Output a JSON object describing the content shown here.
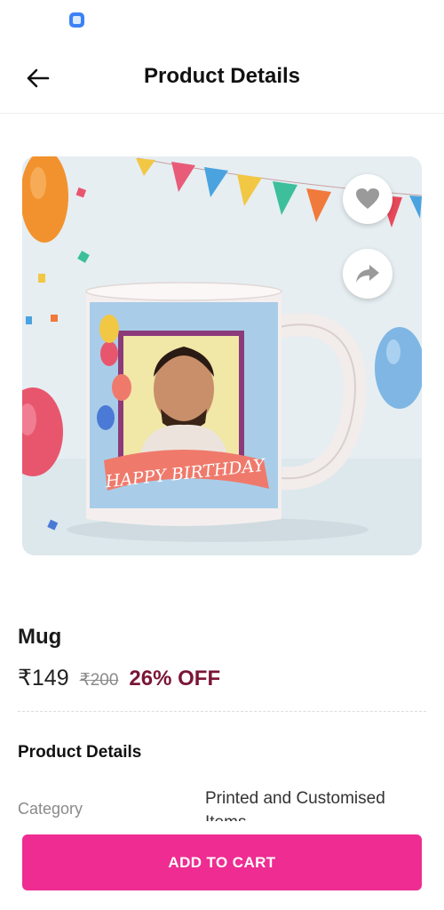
{
  "header": {
    "title": "Product Details",
    "back_icon": "arrow-left-icon"
  },
  "product": {
    "name": "Mug",
    "price": "₹149",
    "mrp": "₹200",
    "discount": "26% OFF",
    "image_text": "HAPPY BIRTHDAY",
    "favorite_icon": "heart-icon",
    "share_icon": "share-icon"
  },
  "details": {
    "heading": "Product Details",
    "rows": [
      {
        "label": "Category",
        "value": "Printed and Customised Items"
      }
    ]
  },
  "actions": {
    "add_to_cart": "ADD TO CART"
  },
  "colors": {
    "accent": "#ee2c92",
    "discount": "#7a1636"
  }
}
